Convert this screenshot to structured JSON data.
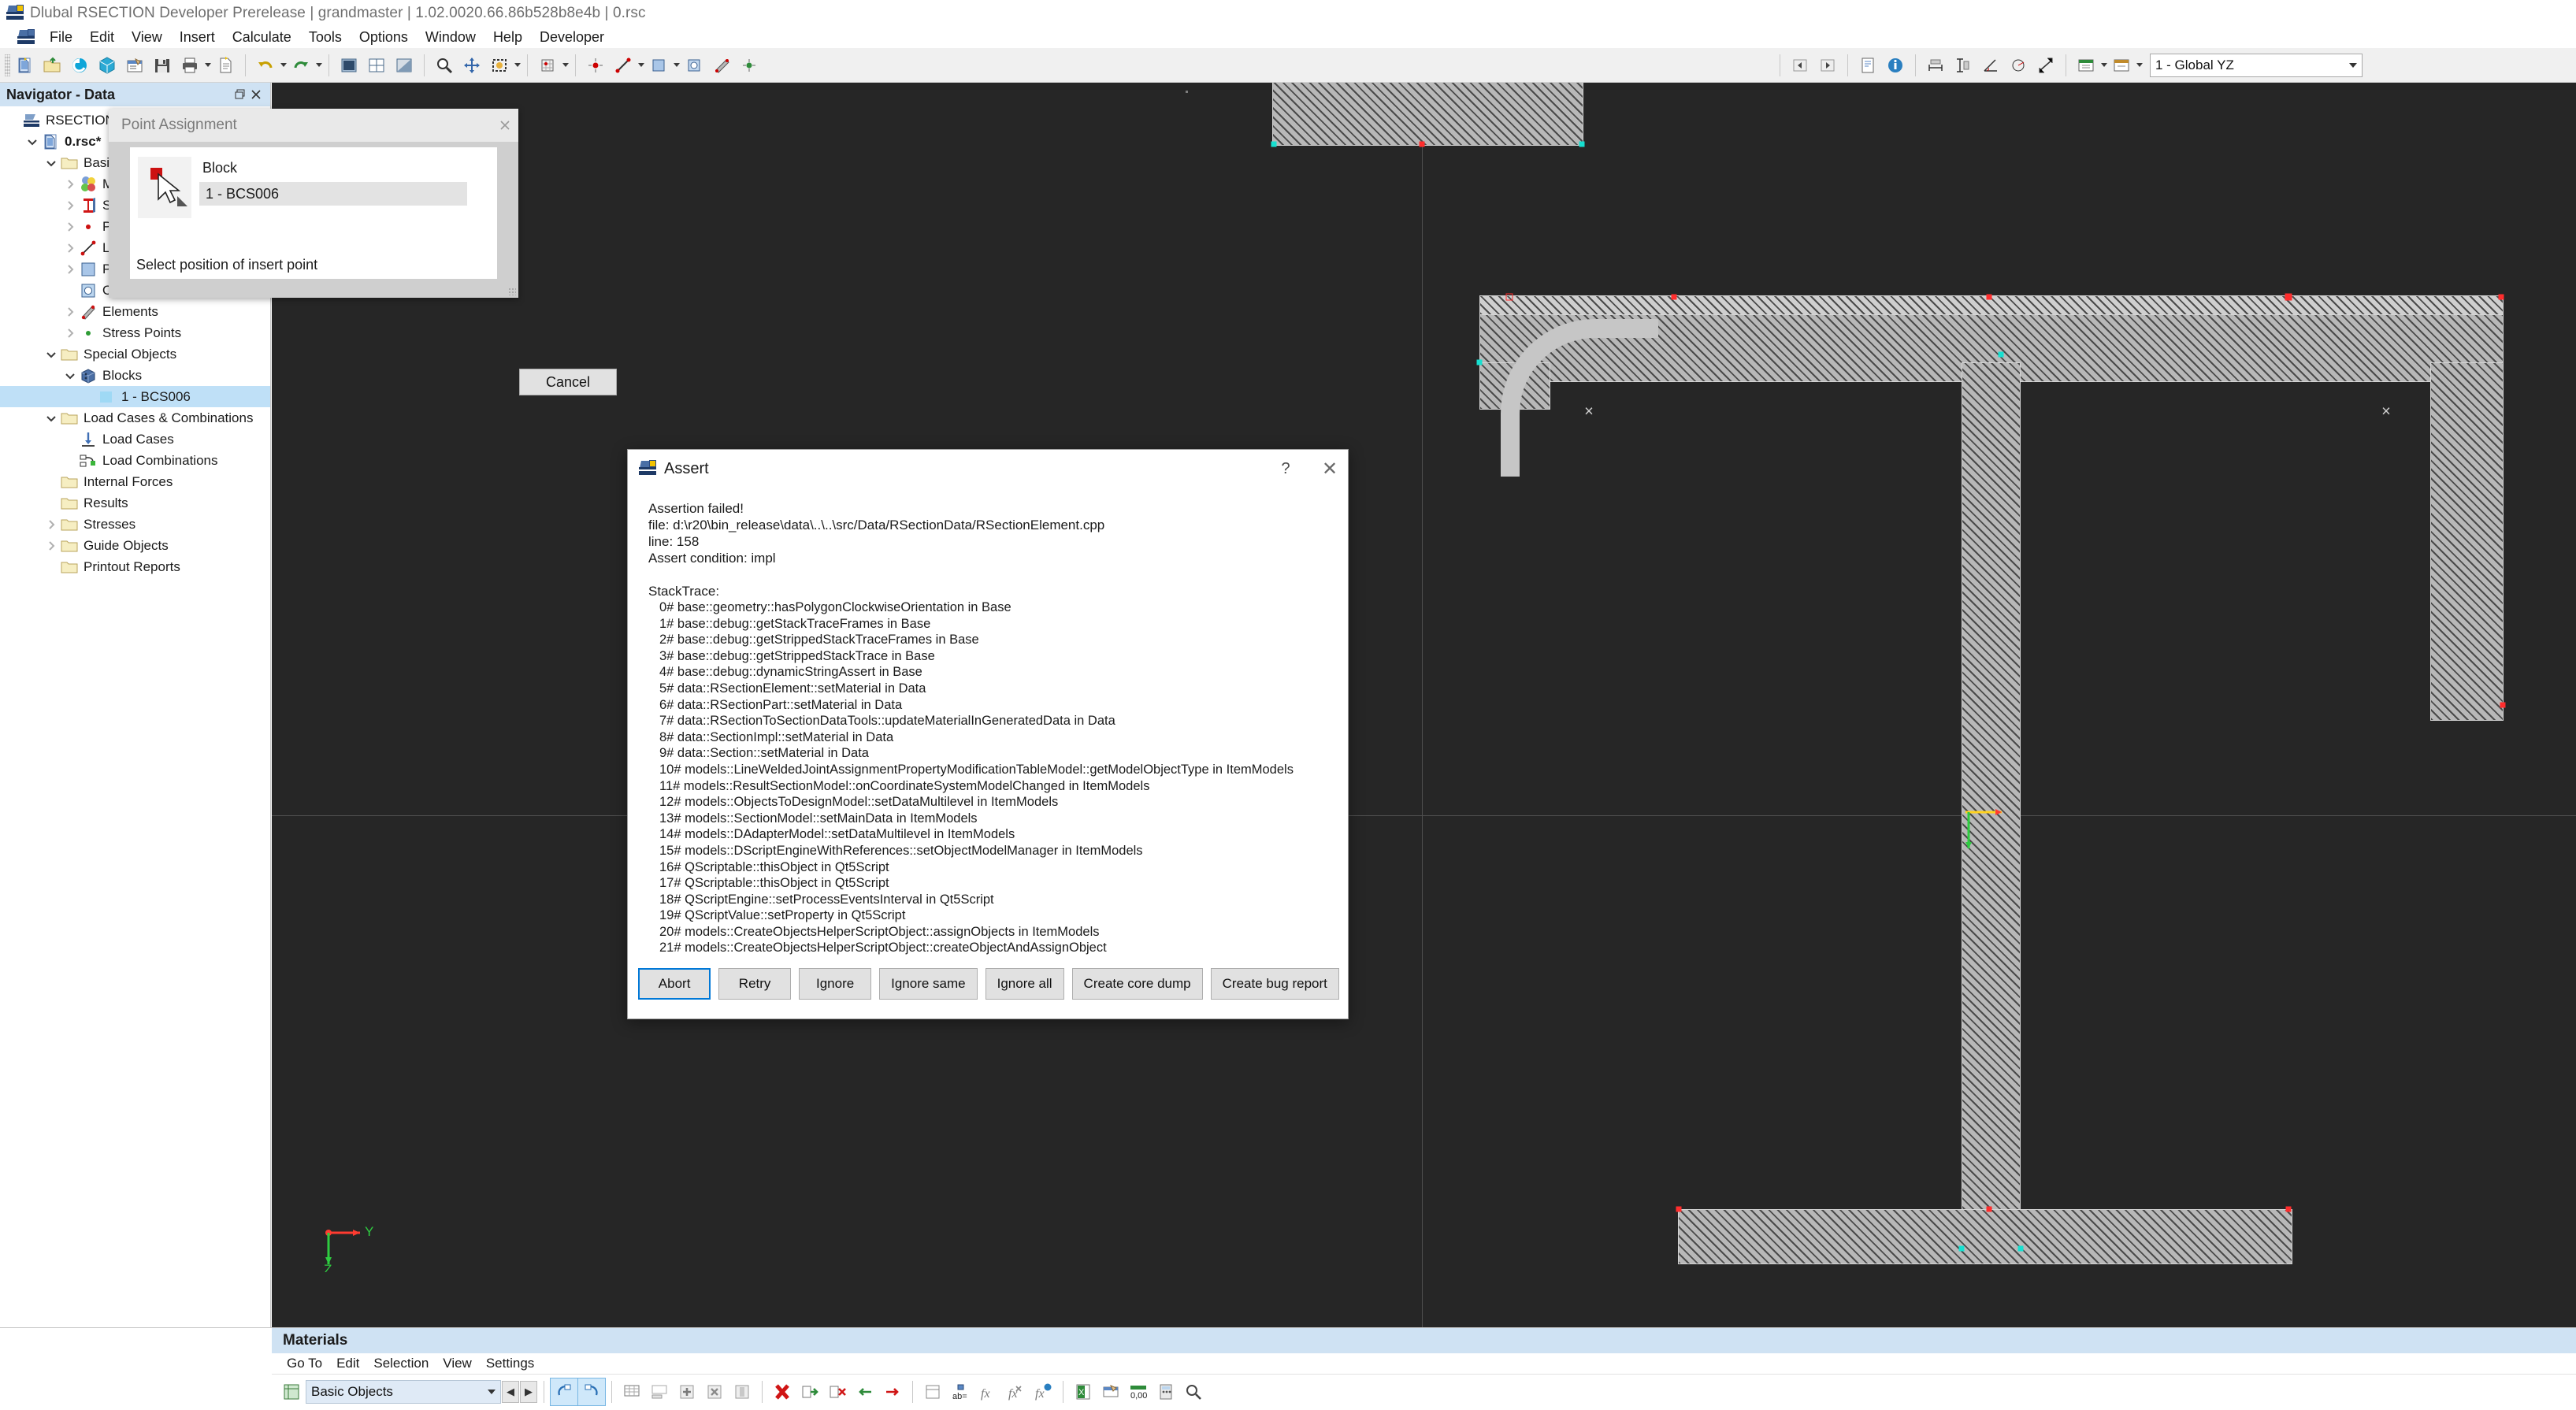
{
  "window": {
    "title": "Dlubal RSECTION Developer Prerelease | grandmaster | 1.02.0020.66.86b528b8e4b | 0.rsc",
    "app_icon": "rsection-app-icon"
  },
  "menubar": {
    "items": [
      {
        "label": "File"
      },
      {
        "label": "Edit"
      },
      {
        "label": "View"
      },
      {
        "label": "Insert"
      },
      {
        "label": "Calculate"
      },
      {
        "label": "Tools"
      },
      {
        "label": "Options"
      },
      {
        "label": "Window"
      },
      {
        "label": "Help"
      },
      {
        "label": "Developer"
      }
    ]
  },
  "toolbar": {
    "view_combo_value": "1 - Global YZ",
    "buttons": [
      {
        "icon": "new-document-icon"
      },
      {
        "icon": "open-folder-icon"
      },
      {
        "icon": "reload-icon"
      },
      {
        "icon": "3d-cube-icon"
      },
      {
        "icon": "table-edit-icon"
      },
      {
        "icon": "save-icon"
      },
      {
        "icon": "print-icon"
      },
      {
        "icon": "print-dropdown-icon"
      },
      {
        "icon": "new-report-icon"
      },
      {
        "icon": "undo-icon"
      },
      {
        "icon": "undo-dropdown-icon"
      },
      {
        "icon": "redo-icon"
      },
      {
        "icon": "redo-dropdown-icon"
      },
      {
        "icon": "render-solid-icon"
      },
      {
        "icon": "render-wire-icon"
      },
      {
        "icon": "render-shade-icon"
      },
      {
        "icon": "render-hidden-icon"
      },
      {
        "icon": "zoom-window-icon"
      },
      {
        "icon": "pan-icon"
      },
      {
        "icon": "zoom-all-icon"
      },
      {
        "icon": "zoom-dropdown-icon"
      },
      {
        "icon": "rotate-icon"
      },
      {
        "icon": "rotate-dropdown-icon"
      },
      {
        "icon": "grid-snap-icon"
      },
      {
        "icon": "grid-dropdown-icon"
      },
      {
        "icon": "point-tool-icon"
      },
      {
        "icon": "line-tool-icon"
      },
      {
        "icon": "line-dropdown-icon"
      },
      {
        "icon": "part-tool-icon"
      },
      {
        "icon": "part-dropdown-icon"
      },
      {
        "icon": "opening-tool-icon"
      },
      {
        "icon": "element-tool-icon"
      },
      {
        "icon": "stresspoint-tool-icon"
      },
      {
        "icon": "prev-view-icon"
      },
      {
        "icon": "next-view-icon"
      },
      {
        "icon": "printout-icon"
      },
      {
        "icon": "info-icon"
      },
      {
        "icon": "dim-horizontal-icon"
      },
      {
        "icon": "dim-vertical-icon"
      },
      {
        "icon": "dim-angle-icon"
      },
      {
        "icon": "dim-radius-icon"
      },
      {
        "icon": "dim-diagonal-icon"
      },
      {
        "icon": "result-table-icon"
      },
      {
        "icon": "result-dropdown-icon"
      },
      {
        "icon": "display-props-icon"
      },
      {
        "icon": "display-dropdown-icon"
      },
      {
        "icon": "view-settings-icon"
      }
    ]
  },
  "navigator": {
    "header": "Navigator - Data",
    "header_buttons": [
      {
        "icon": "undock-icon"
      },
      {
        "icon": "close-icon"
      }
    ],
    "tree": [
      {
        "label": "RSECTION",
        "indent": 0,
        "chev": "none",
        "icon": "rsection-icon",
        "bold": false,
        "selected": false
      },
      {
        "label": "0.rsc*",
        "indent": 1,
        "chev": "expanded",
        "icon": "document-icon",
        "bold": true,
        "selected": false
      },
      {
        "label": "Basic Objects",
        "indent": 2,
        "chev": "expanded",
        "icon": "folder-icon",
        "bold": false,
        "selected": false
      },
      {
        "label": "Materials",
        "indent": 3,
        "chev": "collapsed",
        "icon": "materials-icon",
        "bold": false,
        "selected": false
      },
      {
        "label": "Sections",
        "indent": 3,
        "chev": "collapsed",
        "icon": "section-icon",
        "bold": false,
        "selected": false
      },
      {
        "label": "Points",
        "indent": 3,
        "chev": "collapsed",
        "icon": "point-icon",
        "bold": false,
        "selected": false
      },
      {
        "label": "Lines",
        "indent": 3,
        "chev": "collapsed",
        "icon": "line-icon",
        "bold": false,
        "selected": false
      },
      {
        "label": "Parts",
        "indent": 3,
        "chev": "collapsed",
        "icon": "part-icon",
        "bold": false,
        "selected": false
      },
      {
        "label": "Openings",
        "indent": 3,
        "chev": "none",
        "icon": "opening-icon",
        "bold": false,
        "selected": false
      },
      {
        "label": "Elements",
        "indent": 3,
        "chev": "collapsed",
        "icon": "element-icon",
        "bold": false,
        "selected": false
      },
      {
        "label": "Stress Points",
        "indent": 3,
        "chev": "collapsed",
        "icon": "stresspoint-icon",
        "bold": false,
        "selected": false
      },
      {
        "label": "Special Objects",
        "indent": 2,
        "chev": "expanded",
        "icon": "folder-icon",
        "bold": false,
        "selected": false
      },
      {
        "label": "Blocks",
        "indent": 3,
        "chev": "expanded",
        "icon": "blocks-icon",
        "bold": false,
        "selected": false
      },
      {
        "label": "1 - BCS006",
        "indent": 4,
        "chev": "none",
        "icon": "block-swatch-icon",
        "bold": false,
        "selected": true
      },
      {
        "label": "Load Cases & Combinations",
        "indent": 2,
        "chev": "expanded",
        "icon": "folder-icon",
        "bold": false,
        "selected": false
      },
      {
        "label": "Load Cases",
        "indent": 3,
        "chev": "none",
        "icon": "loadcase-icon",
        "bold": false,
        "selected": false
      },
      {
        "label": "Load Combinations",
        "indent": 3,
        "chev": "none",
        "icon": "loadcombo-icon",
        "bold": false,
        "selected": false
      },
      {
        "label": "Internal Forces",
        "indent": 2,
        "chev": "none",
        "icon": "folder-icon",
        "bold": false,
        "selected": false
      },
      {
        "label": "Results",
        "indent": 2,
        "chev": "none",
        "icon": "folder-icon",
        "bold": false,
        "selected": false
      },
      {
        "label": "Stresses",
        "indent": 2,
        "chev": "collapsed",
        "icon": "folder-icon",
        "bold": false,
        "selected": false
      },
      {
        "label": "Guide Objects",
        "indent": 2,
        "chev": "collapsed",
        "icon": "folder-icon",
        "bold": false,
        "selected": false
      },
      {
        "label": "Printout Reports",
        "indent": 2,
        "chev": "none",
        "icon": "folder-icon",
        "bold": false,
        "selected": false
      }
    ]
  },
  "point_assignment": {
    "title": "Point Assignment",
    "field_label": "Block",
    "field_value": "1 - BCS006",
    "hint": "Select position of insert point",
    "cancel_label": "Cancel",
    "close_icon": "close-icon",
    "cursor_icon": "insert-point-cursor-icon"
  },
  "assert_dialog": {
    "title": "Assert",
    "icon": "rsection-app-icon",
    "help_label": "?",
    "close_label": "✕",
    "header_lines": [
      "Assertion failed!",
      "file: d:\\r20\\bin_release\\data\\..\\..\\src/Data/RSectionData/RSectionElement.cpp",
      "line: 158",
      "Assert condition: impl"
    ],
    "stacktrace_label": "StackTrace:",
    "stacktrace": [
      "0# base::geometry::hasPolygonClockwiseOrientation in Base",
      "1# base::debug::getStackTraceFrames in Base",
      "2# base::debug::getStrippedStackTraceFrames in Base",
      "3# base::debug::getStrippedStackTrace in Base",
      "4# base::debug::dynamicStringAssert in Base",
      "5# data::RSectionElement::setMaterial in Data",
      "6# data::RSectionPart::setMaterial in Data",
      "7# data::RSectionToSectionDataTools::updateMaterialInGeneratedData in Data",
      "8# data::SectionImpl::setMaterial in Data",
      "9# data::Section::setMaterial in Data",
      "10# models::LineWeldedJointAssignmentPropertyModificationTableModel::getModelObjectType in ItemModels",
      "11# models::ResultSectionModel::onCoordinateSystemModelChanged in ItemModels",
      "12# models::ObjectsToDesignModel::setDataMultilevel in ItemModels",
      "13# models::SectionModel::setMainData in ItemModels",
      "14# models::DAdapterModel::setDataMultilevel in ItemModels",
      "15# models::DScriptEngineWithReferences::setObjectModelManager in ItemModels",
      "16# QScriptable::thisObject in Qt5Script",
      "17# QScriptable::thisObject in Qt5Script",
      "18# QScriptEngine::setProcessEventsInterval in Qt5Script",
      "19# QScriptValue::setProperty in Qt5Script",
      "20# models::CreateObjectsHelperScriptObject::assignObjects in ItemModels",
      "21# models::CreateObjectsHelperScriptObject::createObjectAndAssignObject"
    ],
    "buttons": [
      {
        "label": "Abort",
        "primary": true
      },
      {
        "label": "Retry",
        "primary": false
      },
      {
        "label": "Ignore",
        "primary": false
      },
      {
        "label": "Ignore same",
        "primary": false
      },
      {
        "label": "Ignore all",
        "primary": false
      },
      {
        "label": "Create core dump",
        "primary": false
      },
      {
        "label": "Create bug report",
        "primary": false
      }
    ]
  },
  "materials_panel": {
    "title": "Materials",
    "menu": [
      {
        "label": "Go To"
      },
      {
        "label": "Edit"
      },
      {
        "label": "Selection"
      },
      {
        "label": "View"
      },
      {
        "label": "Settings"
      }
    ],
    "combo_value": "Basic Objects",
    "nav_prev_icon": "prev-arrow-icon",
    "nav_next_icon": "next-arrow-icon",
    "buttons": [
      {
        "icon": "undo-table-icon",
        "active": true
      },
      {
        "icon": "redo-table-icon",
        "active": true
      },
      {
        "icon": "table-grid-icon",
        "active": false
      },
      {
        "icon": "table-footer-icon",
        "active": false
      },
      {
        "icon": "insert-row-icon",
        "active": false
      },
      {
        "icon": "delete-row-icon",
        "active": false
      },
      {
        "icon": "column-icon",
        "active": false
      },
      {
        "icon": "delete-all-icon",
        "active": false
      },
      {
        "icon": "import-icon",
        "active": false
      },
      {
        "icon": "remove-import-icon",
        "active": false
      },
      {
        "icon": "move-left-icon",
        "active": false
      },
      {
        "icon": "move-right-icon",
        "active": false
      },
      {
        "icon": "blank-table-icon",
        "active": false
      },
      {
        "icon": "abeq-icon",
        "active": false
      },
      {
        "icon": "fx-icon",
        "active": false
      },
      {
        "icon": "fx-cut-icon",
        "active": false
      },
      {
        "icon": "fx-help-icon",
        "active": false
      },
      {
        "icon": "excel-export-icon",
        "active": false
      },
      {
        "icon": "table-print-icon",
        "active": false
      },
      {
        "icon": "decimals-icon",
        "active": false
      },
      {
        "icon": "calculator-icon",
        "active": false
      },
      {
        "icon": "units-icon",
        "active": false
      },
      {
        "icon": "search-icon",
        "active": false
      }
    ]
  },
  "viewport": {
    "axis_labels": {
      "y": "Y",
      "z": "Z"
    },
    "background_color": "#262626",
    "section_color": "#b9b9b9"
  }
}
